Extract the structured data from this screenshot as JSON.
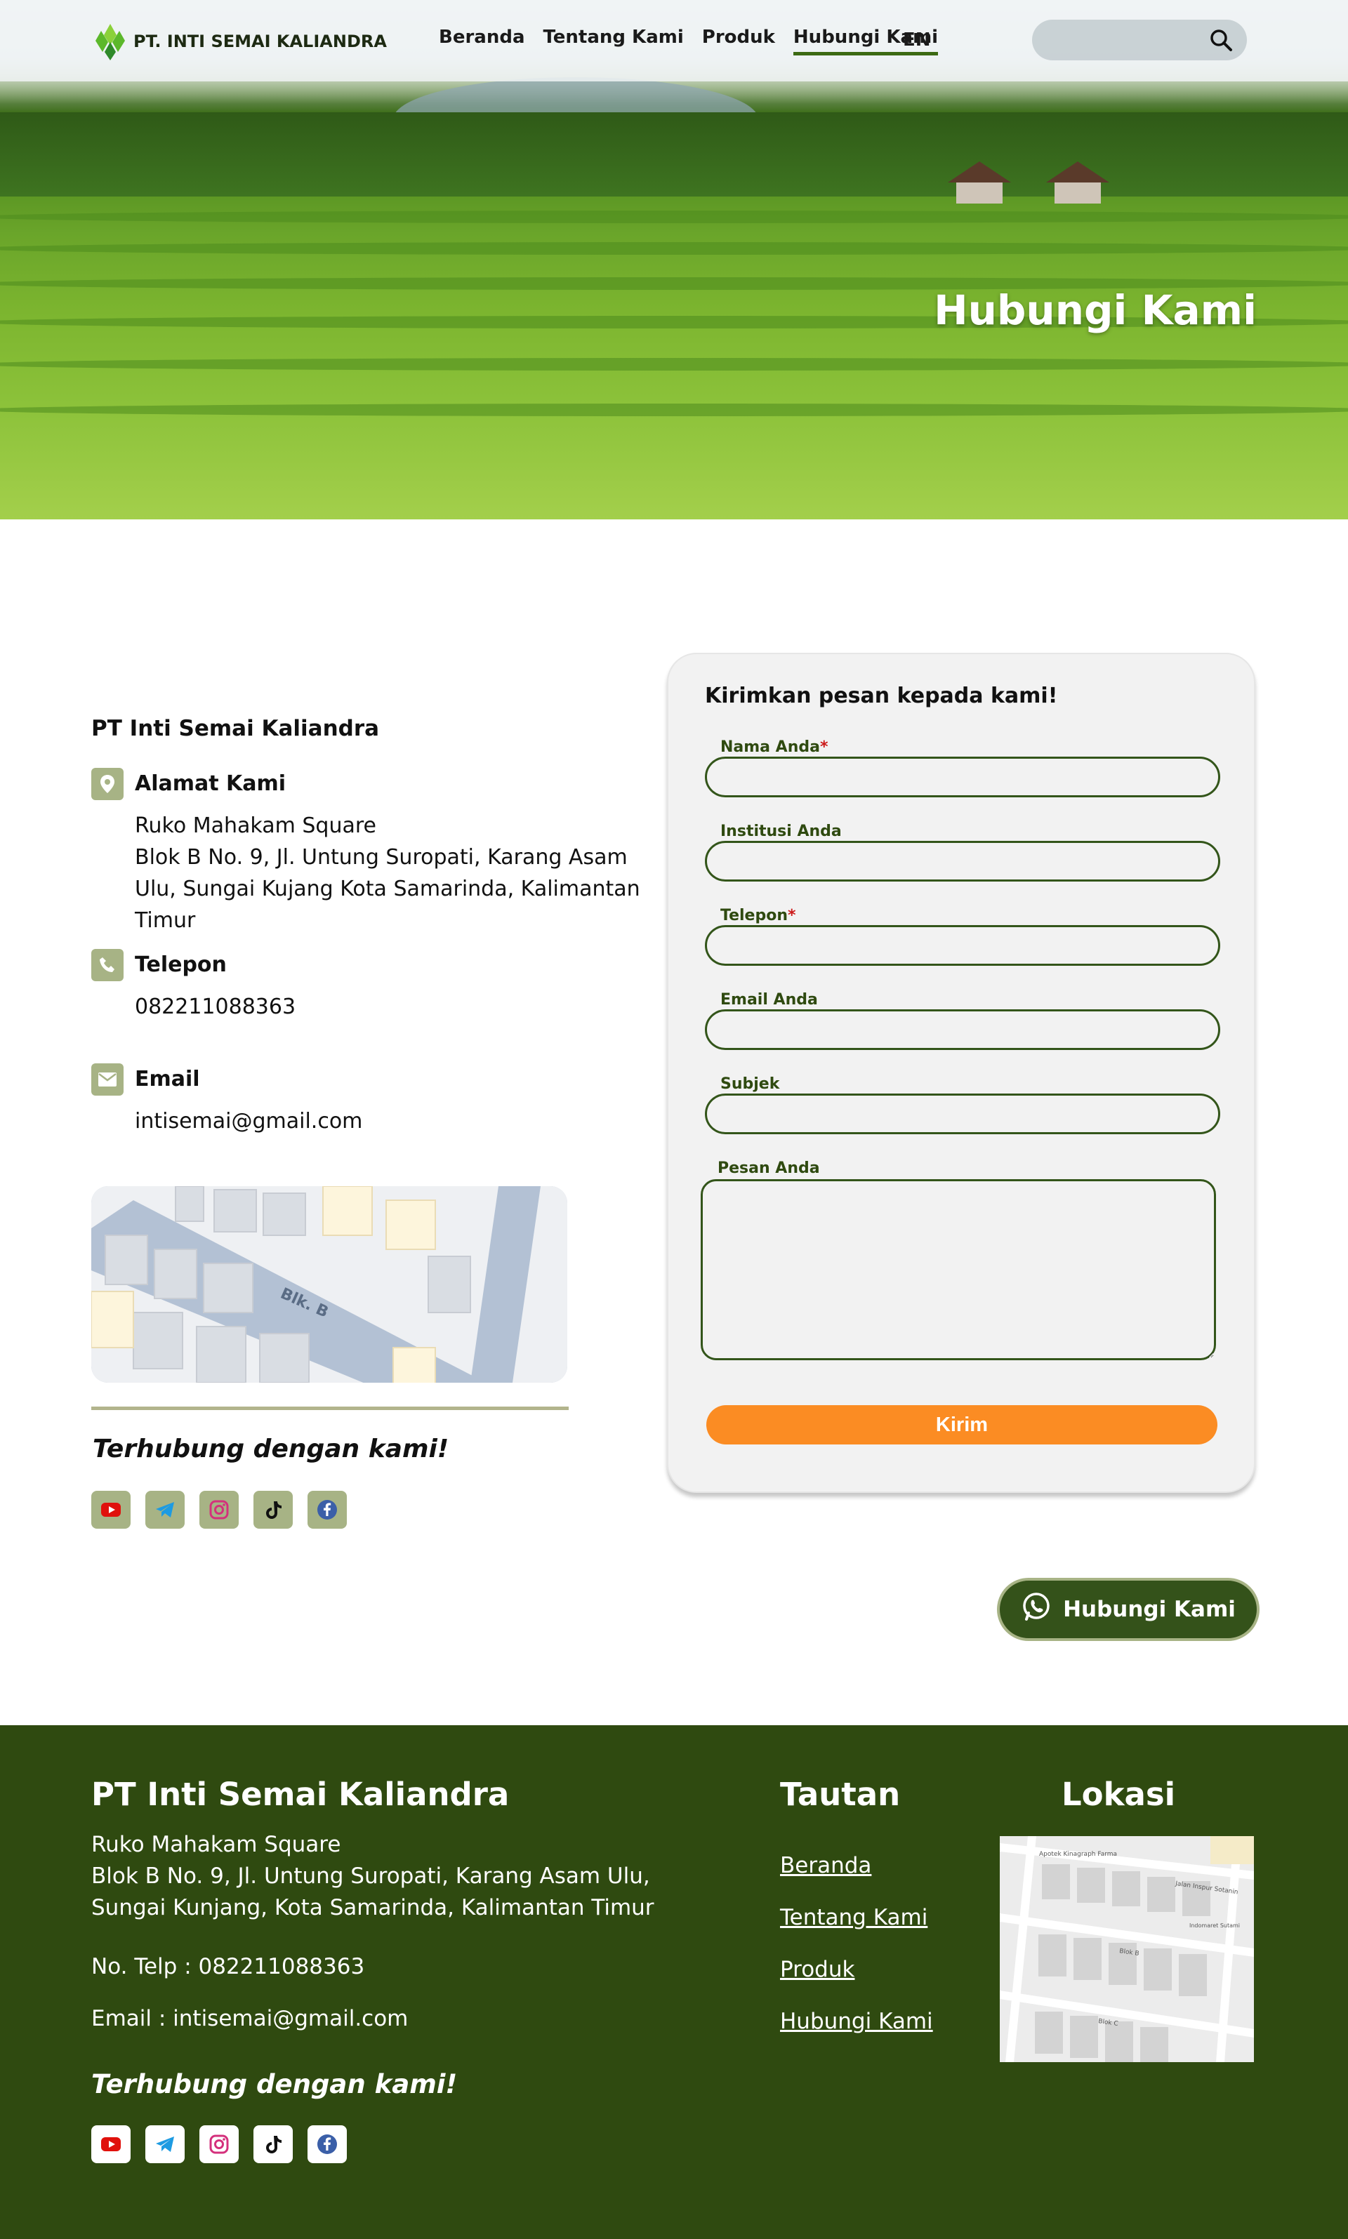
{
  "brand": {
    "name": "PT. INTI SEMAI KALIANDRA"
  },
  "nav": {
    "items": [
      {
        "label": "Beranda"
      },
      {
        "label": "Tentang Kami"
      },
      {
        "label": "Produk"
      },
      {
        "label": "Hubungi Kami",
        "active": true
      }
    ],
    "lang": "EN",
    "search_icon": "search-icon"
  },
  "hero": {
    "title": "Hubungi Kami"
  },
  "contact": {
    "company": "PT Inti Semai Kaliandra",
    "address": {
      "title": "Alamat Kami",
      "line1": "Ruko Mahakam Square",
      "line2": "Blok B No. 9,  Jl. Untung Suropati, Karang Asam Ulu, Sungai Kujang Kota Samarinda, Kalimantan Timur"
    },
    "phone": {
      "title": "Telepon",
      "value": "082211088363"
    },
    "email": {
      "title": "Email",
      "value": "intisemai@gmail.com"
    },
    "map_label": "Blk. B",
    "connect": "Terhubung dengan kami!"
  },
  "form": {
    "title": "Kirimkan pesan kepada kami!",
    "name_label": "Nama Anda",
    "institution_label": "Institusi Anda",
    "phone_label": "Telepon",
    "email_label": "Email Anda",
    "subject_label": "Subjek",
    "message_label": "Pesan Anda",
    "required_mark": "*",
    "submit": "Kirim"
  },
  "whatsapp": {
    "label": "Hubungi Kami"
  },
  "footer": {
    "title": "PT Inti Semai Kaliandra",
    "addr1": "Ruko Mahakam Square",
    "addr2": "Blok B No. 9, Jl. Untung Suropati, Karang Asam Ulu,",
    "addr3": "Sungai Kunjang, Kota Samarinda, Kalimantan Timur",
    "tel": "No. Telp : 082211088363",
    "email": "Email : intisemai@gmail.com",
    "connect": "Terhubung dengan kami!",
    "links_title": "Tautan",
    "links": [
      {
        "label": "Beranda"
      },
      {
        "label": "Tentang Kami"
      },
      {
        "label": "Produk"
      },
      {
        "label": "Hubungi Kami"
      }
    ],
    "location_title": "Lokasi",
    "map_labels": [
      "Apotek Kinagraph Farma",
      "Jalan Inspur Sotanin",
      "Blok B",
      "Blok C",
      "Indomaret Sutami"
    ]
  },
  "colors": {
    "accent": "#fb8c23",
    "brand_green": "#2f4a10",
    "icon_bg": "#a7b385"
  },
  "socials": [
    "youtube-icon",
    "telegram-icon",
    "instagram-icon",
    "tiktok-icon",
    "facebook-icon"
  ]
}
